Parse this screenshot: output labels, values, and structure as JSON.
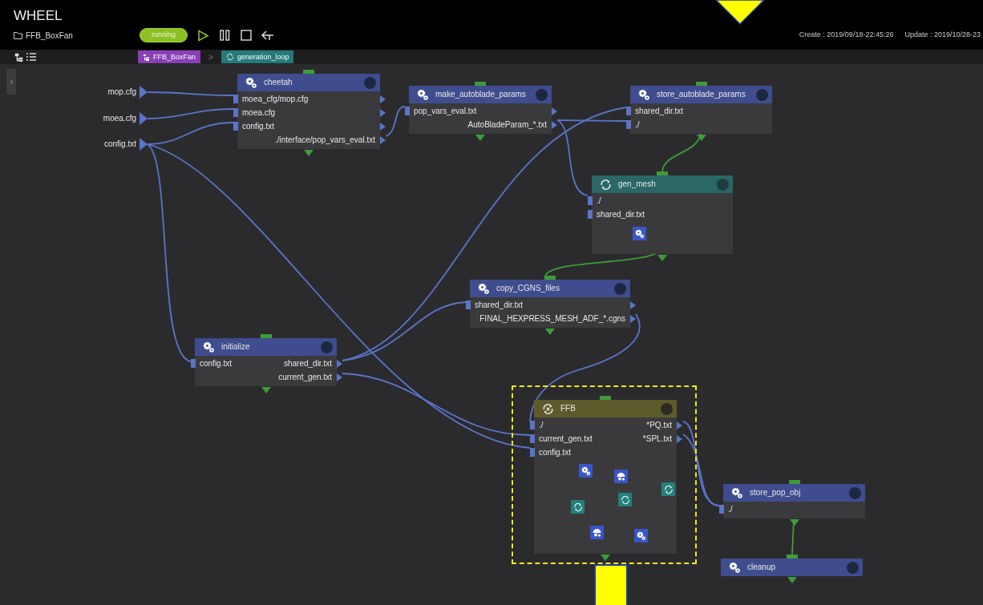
{
  "window": {
    "title": "WHEEL"
  },
  "project": {
    "name": "FFB_BoxFan",
    "status": "running"
  },
  "timestamps": {
    "create": "Create : 2019/09/18-22:45:26",
    "update": "Update : 2019/10/28-23"
  },
  "breadcrumb": {
    "separator": ">",
    "items": [
      {
        "kind": "workflow",
        "label": "FFB_BoxFan"
      },
      {
        "kind": "loop",
        "label": "generation_loop"
      }
    ]
  },
  "source_files": [
    {
      "label": "mop.cfg"
    },
    {
      "label": "moea.cfg"
    },
    {
      "label": "config.txt"
    }
  ],
  "nodes": [
    {
      "name": "cheetah",
      "kind": "task",
      "inputs": [
        "moea_cfg/mop.cfg",
        "moea.cfg",
        "config.txt"
      ],
      "outputs": [
        {
          "kind": "port"
        },
        {
          "kind": "port"
        },
        {
          "kind": "port"
        },
        {
          "kind": "file",
          "label": "./interface/pop_vars_eval.txt"
        }
      ]
    },
    {
      "name": "make_autoblade_params",
      "kind": "task",
      "inputs": [
        "pop_vars_eval.txt"
      ],
      "outputs": [
        {
          "kind": "port"
        },
        {
          "kind": "file",
          "label": "AutoBladeParam_*.txt"
        }
      ]
    },
    {
      "name": "store_autoblade_params",
      "kind": "task",
      "inputs": [
        "shared_dir.txt",
        "./"
      ]
    },
    {
      "name": "gen_mesh",
      "kind": "loop",
      "inputs": [
        "./",
        "shared_dir.txt"
      ],
      "children": [
        {
          "kind": "task"
        }
      ]
    },
    {
      "name": "copy_CGNS_files",
      "kind": "task",
      "inputs": [
        "shared_dir.txt"
      ],
      "outputs": [
        {
          "kind": "port"
        },
        {
          "kind": "file",
          "label": "FINAL_HEXPRESS_MESH_ADF_*.cgns"
        }
      ]
    },
    {
      "name": "initialize",
      "kind": "task",
      "inputs": [
        "config.txt"
      ],
      "outputs": [
        {
          "kind": "file",
          "label": "shared_dir.txt"
        },
        {
          "kind": "file",
          "label": "current_gen.txt"
        }
      ]
    },
    {
      "name": "FFB",
      "kind": "ps",
      "inputs": [
        "./",
        "current_gen.txt",
        "config.txt"
      ],
      "outputs": [
        {
          "kind": "file",
          "label": "*PQ.txt"
        },
        {
          "kind": "file",
          "label": "*SPL.txt"
        }
      ],
      "children": [
        {
          "kind": "task"
        },
        {
          "kind": "remote"
        },
        {
          "kind": "loop"
        },
        {
          "kind": "loop"
        },
        {
          "kind": "loop"
        },
        {
          "kind": "remote"
        },
        {
          "kind": "task"
        }
      ]
    },
    {
      "name": "store_pop_obj",
      "kind": "task",
      "inputs": [
        "./"
      ]
    },
    {
      "name": "cleanup",
      "kind": "task"
    }
  ]
}
